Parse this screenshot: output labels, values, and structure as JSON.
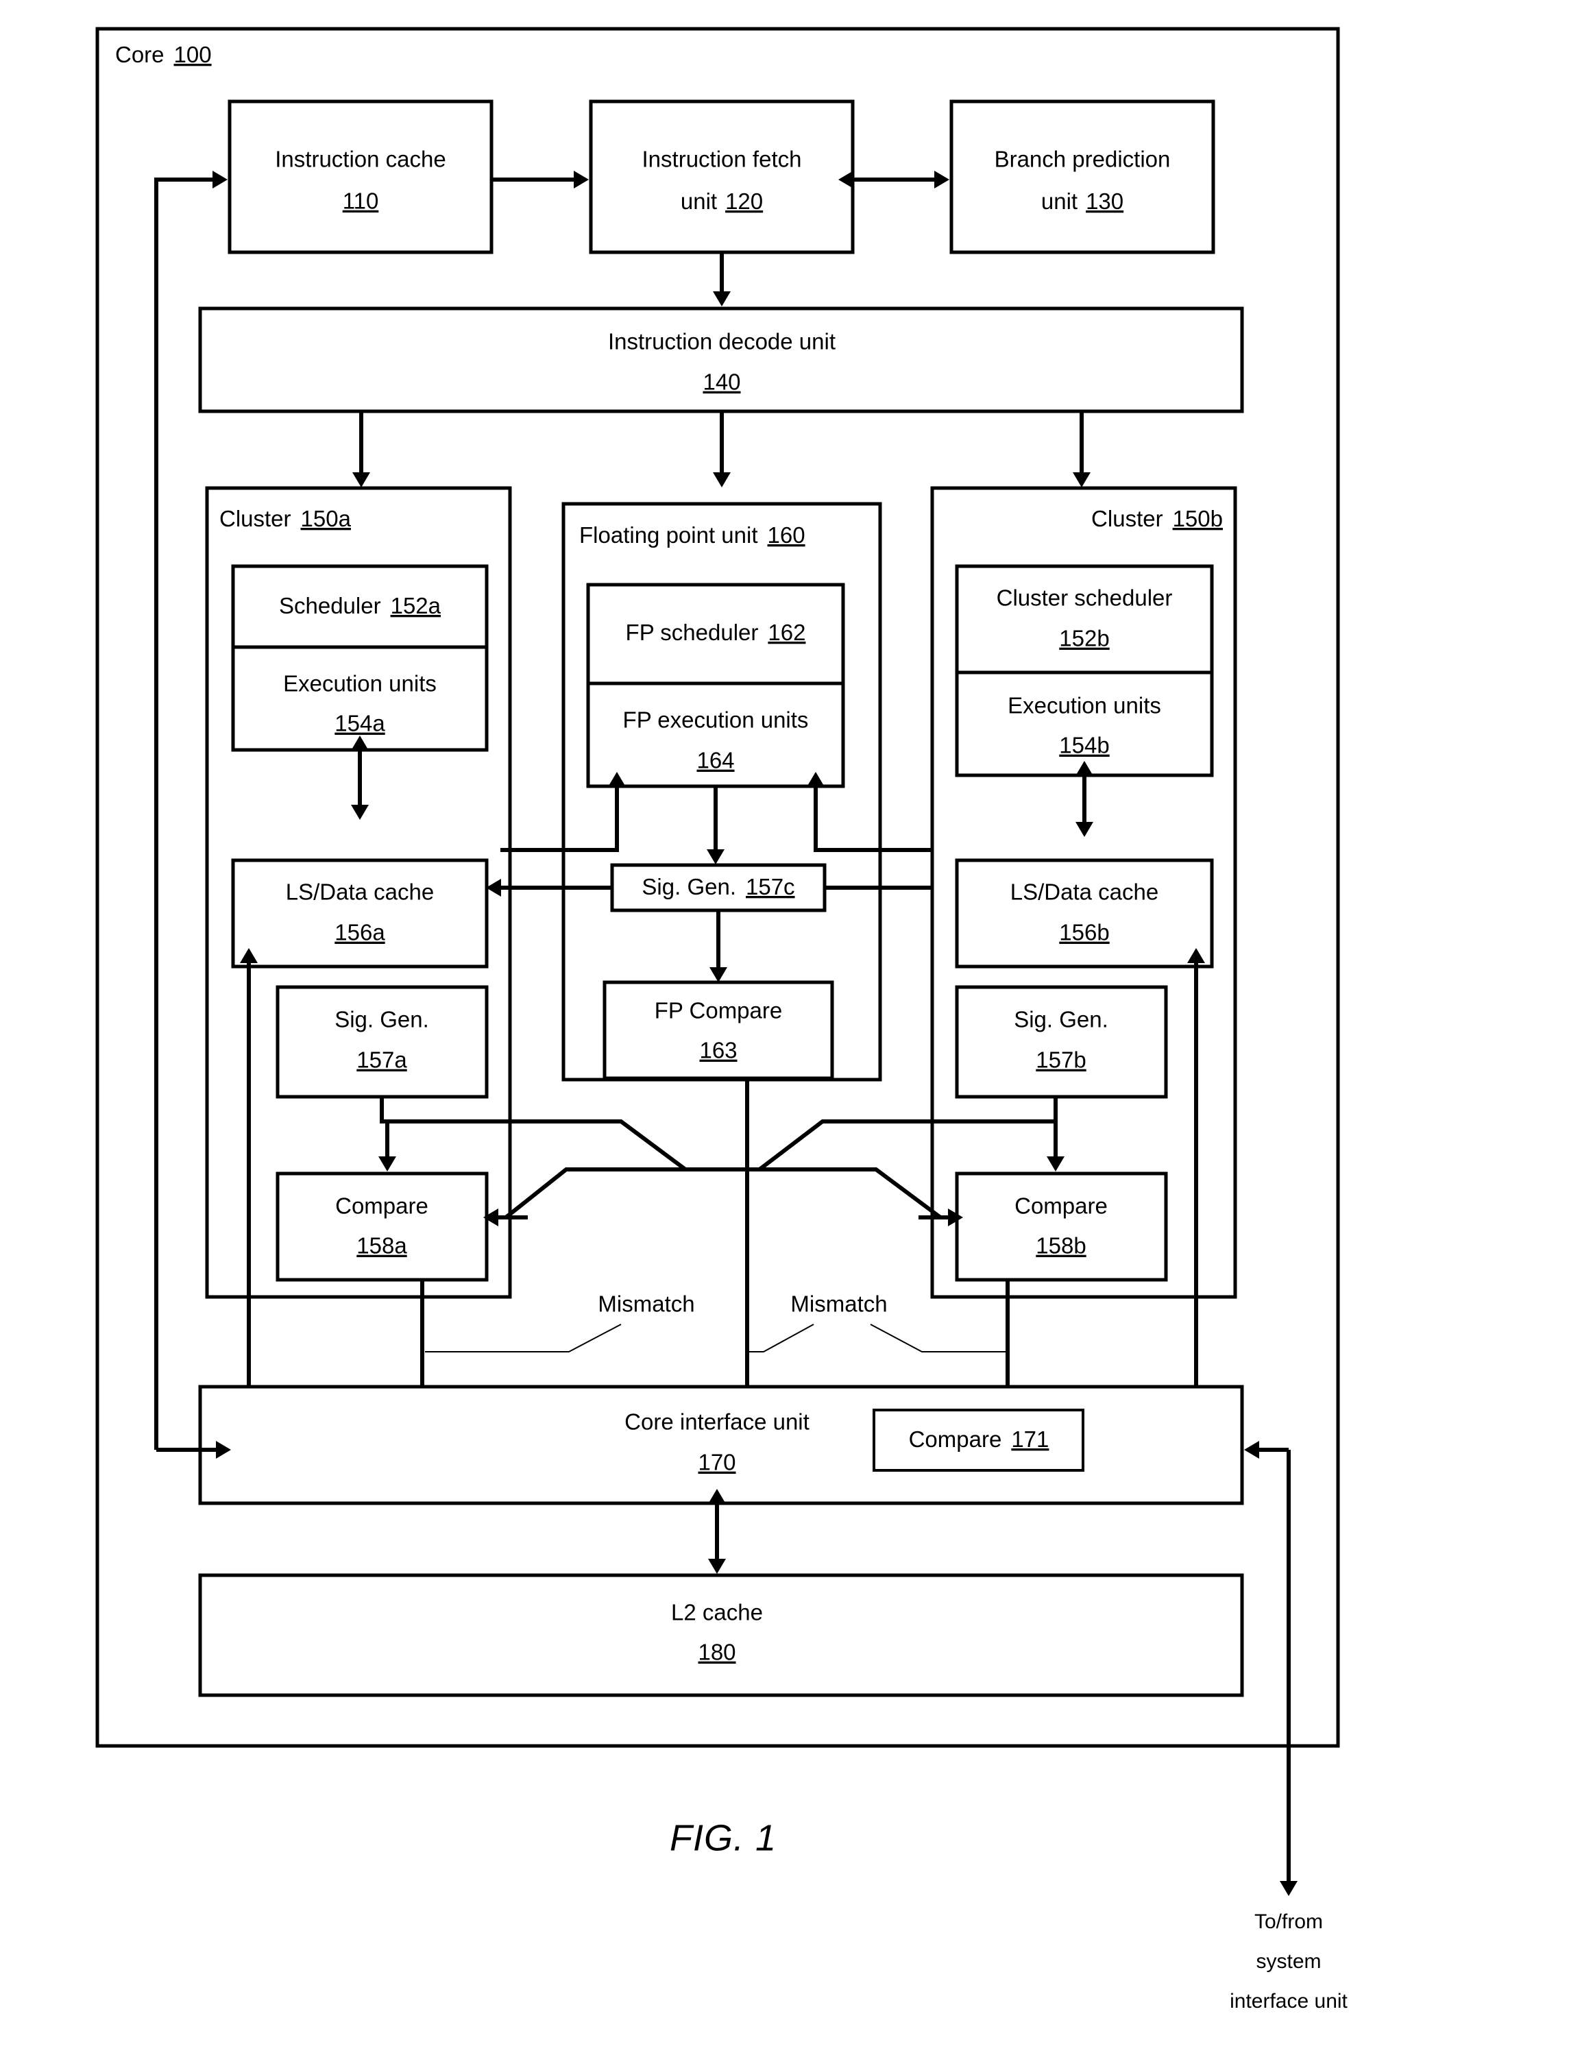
{
  "figure": {
    "caption": "FIG. 1",
    "outer_label": "Core",
    "outer_ref": "100",
    "external_note_line1": "To/from",
    "external_note_line2": "system",
    "external_note_line3": "interface unit"
  },
  "blocks": {
    "instruction_cache": {
      "label": "Instruction cache",
      "ref": "110"
    },
    "instruction_fetch": {
      "label": "Instruction fetch",
      "label2": "unit",
      "ref": "120"
    },
    "branch_prediction": {
      "label": "Branch prediction",
      "label2": "unit",
      "ref": "130"
    },
    "instruction_decode": {
      "label": "Instruction decode unit",
      "ref": "140"
    },
    "cluster_a": {
      "label": "Cluster",
      "ref": "150a"
    },
    "cluster_b": {
      "label": "Cluster",
      "ref": "150b"
    },
    "fpu": {
      "label": "Floating point unit",
      "ref": "160"
    },
    "scheduler_a": {
      "label": "Scheduler",
      "ref": "152a"
    },
    "exec_units_a": {
      "label": "Execution units",
      "ref": "154a"
    },
    "cluster_scheduler_b": {
      "label": "Cluster scheduler",
      "ref": "152b"
    },
    "exec_units_b": {
      "label": "Execution units",
      "ref": "154b"
    },
    "fp_scheduler": {
      "label": "FP scheduler",
      "ref": "162"
    },
    "fp_exec_units": {
      "label": "FP execution units",
      "ref": "164"
    },
    "ls_data_cache_a": {
      "label": "LS/Data cache",
      "ref": "156a"
    },
    "ls_data_cache_b": {
      "label": "LS/Data cache",
      "ref": "156b"
    },
    "sig_gen_c": {
      "label": "Sig. Gen.",
      "ref": "157c"
    },
    "sig_gen_a": {
      "label": "Sig. Gen.",
      "ref": "157a"
    },
    "sig_gen_b": {
      "label": "Sig. Gen.",
      "ref": "157b"
    },
    "fp_compare": {
      "label": "FP Compare",
      "ref": "163"
    },
    "compare_a": {
      "label": "Compare",
      "ref": "158a"
    },
    "compare_b": {
      "label": "Compare",
      "ref": "158b"
    },
    "core_interface": {
      "label": "Core interface unit",
      "ref": "170"
    },
    "compare_171": {
      "label": "Compare",
      "ref": "171"
    },
    "l2_cache": {
      "label": "L2 cache",
      "ref": "180"
    }
  },
  "annotations": {
    "mismatch_left": "Mismatch",
    "mismatch_right": "Mismatch"
  },
  "colors": {
    "stroke": "#000000",
    "fill": "#ffffff",
    "background": "#ffffff"
  }
}
